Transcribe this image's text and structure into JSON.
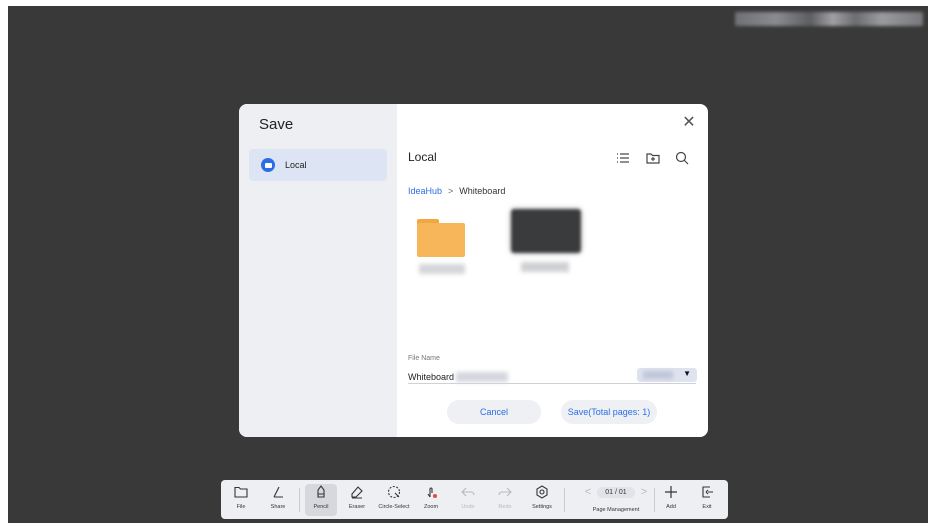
{
  "dialog": {
    "title": "Save",
    "sidebar": {
      "items": [
        {
          "label": "Local"
        }
      ]
    },
    "location_title": "Local",
    "breadcrumb": [
      "IdeaHub",
      "Whiteboard"
    ],
    "breadcrumb_separator": ">",
    "file_name_label": "File Name",
    "file_name_value": "Whiteboard",
    "cancel_label": "Cancel",
    "save_label": "Save(Total pages: 1)",
    "close_glyph": "✕"
  },
  "toolbar": {
    "items": [
      {
        "label": "File",
        "icon": "folder-icon"
      },
      {
        "label": "Share",
        "icon": "share-icon"
      },
      {
        "label": "Pencil",
        "icon": "pencil-icon"
      },
      {
        "label": "Eraser",
        "icon": "eraser-icon"
      },
      {
        "label": "Circle-Select",
        "icon": "circle-select-icon"
      },
      {
        "label": "Zoom",
        "icon": "zoom-icon"
      },
      {
        "label": "Undo",
        "icon": "undo-icon"
      },
      {
        "label": "Redo",
        "icon": "redo-icon"
      },
      {
        "label": "Settings",
        "icon": "settings-icon"
      },
      {
        "label": "Add",
        "icon": "add-icon"
      },
      {
        "label": "Exit",
        "icon": "exit-icon"
      }
    ],
    "page_indicator": "01 / 01",
    "page_management_label": "Page Management",
    "prev_glyph": "<",
    "next_glyph": ">"
  },
  "colors": {
    "canvas": "#393939",
    "accent": "#2a6ee6",
    "folder": "#f7b65a",
    "sidebar_bg": "#eeeff2",
    "selected_bg": "#dde5f4"
  }
}
